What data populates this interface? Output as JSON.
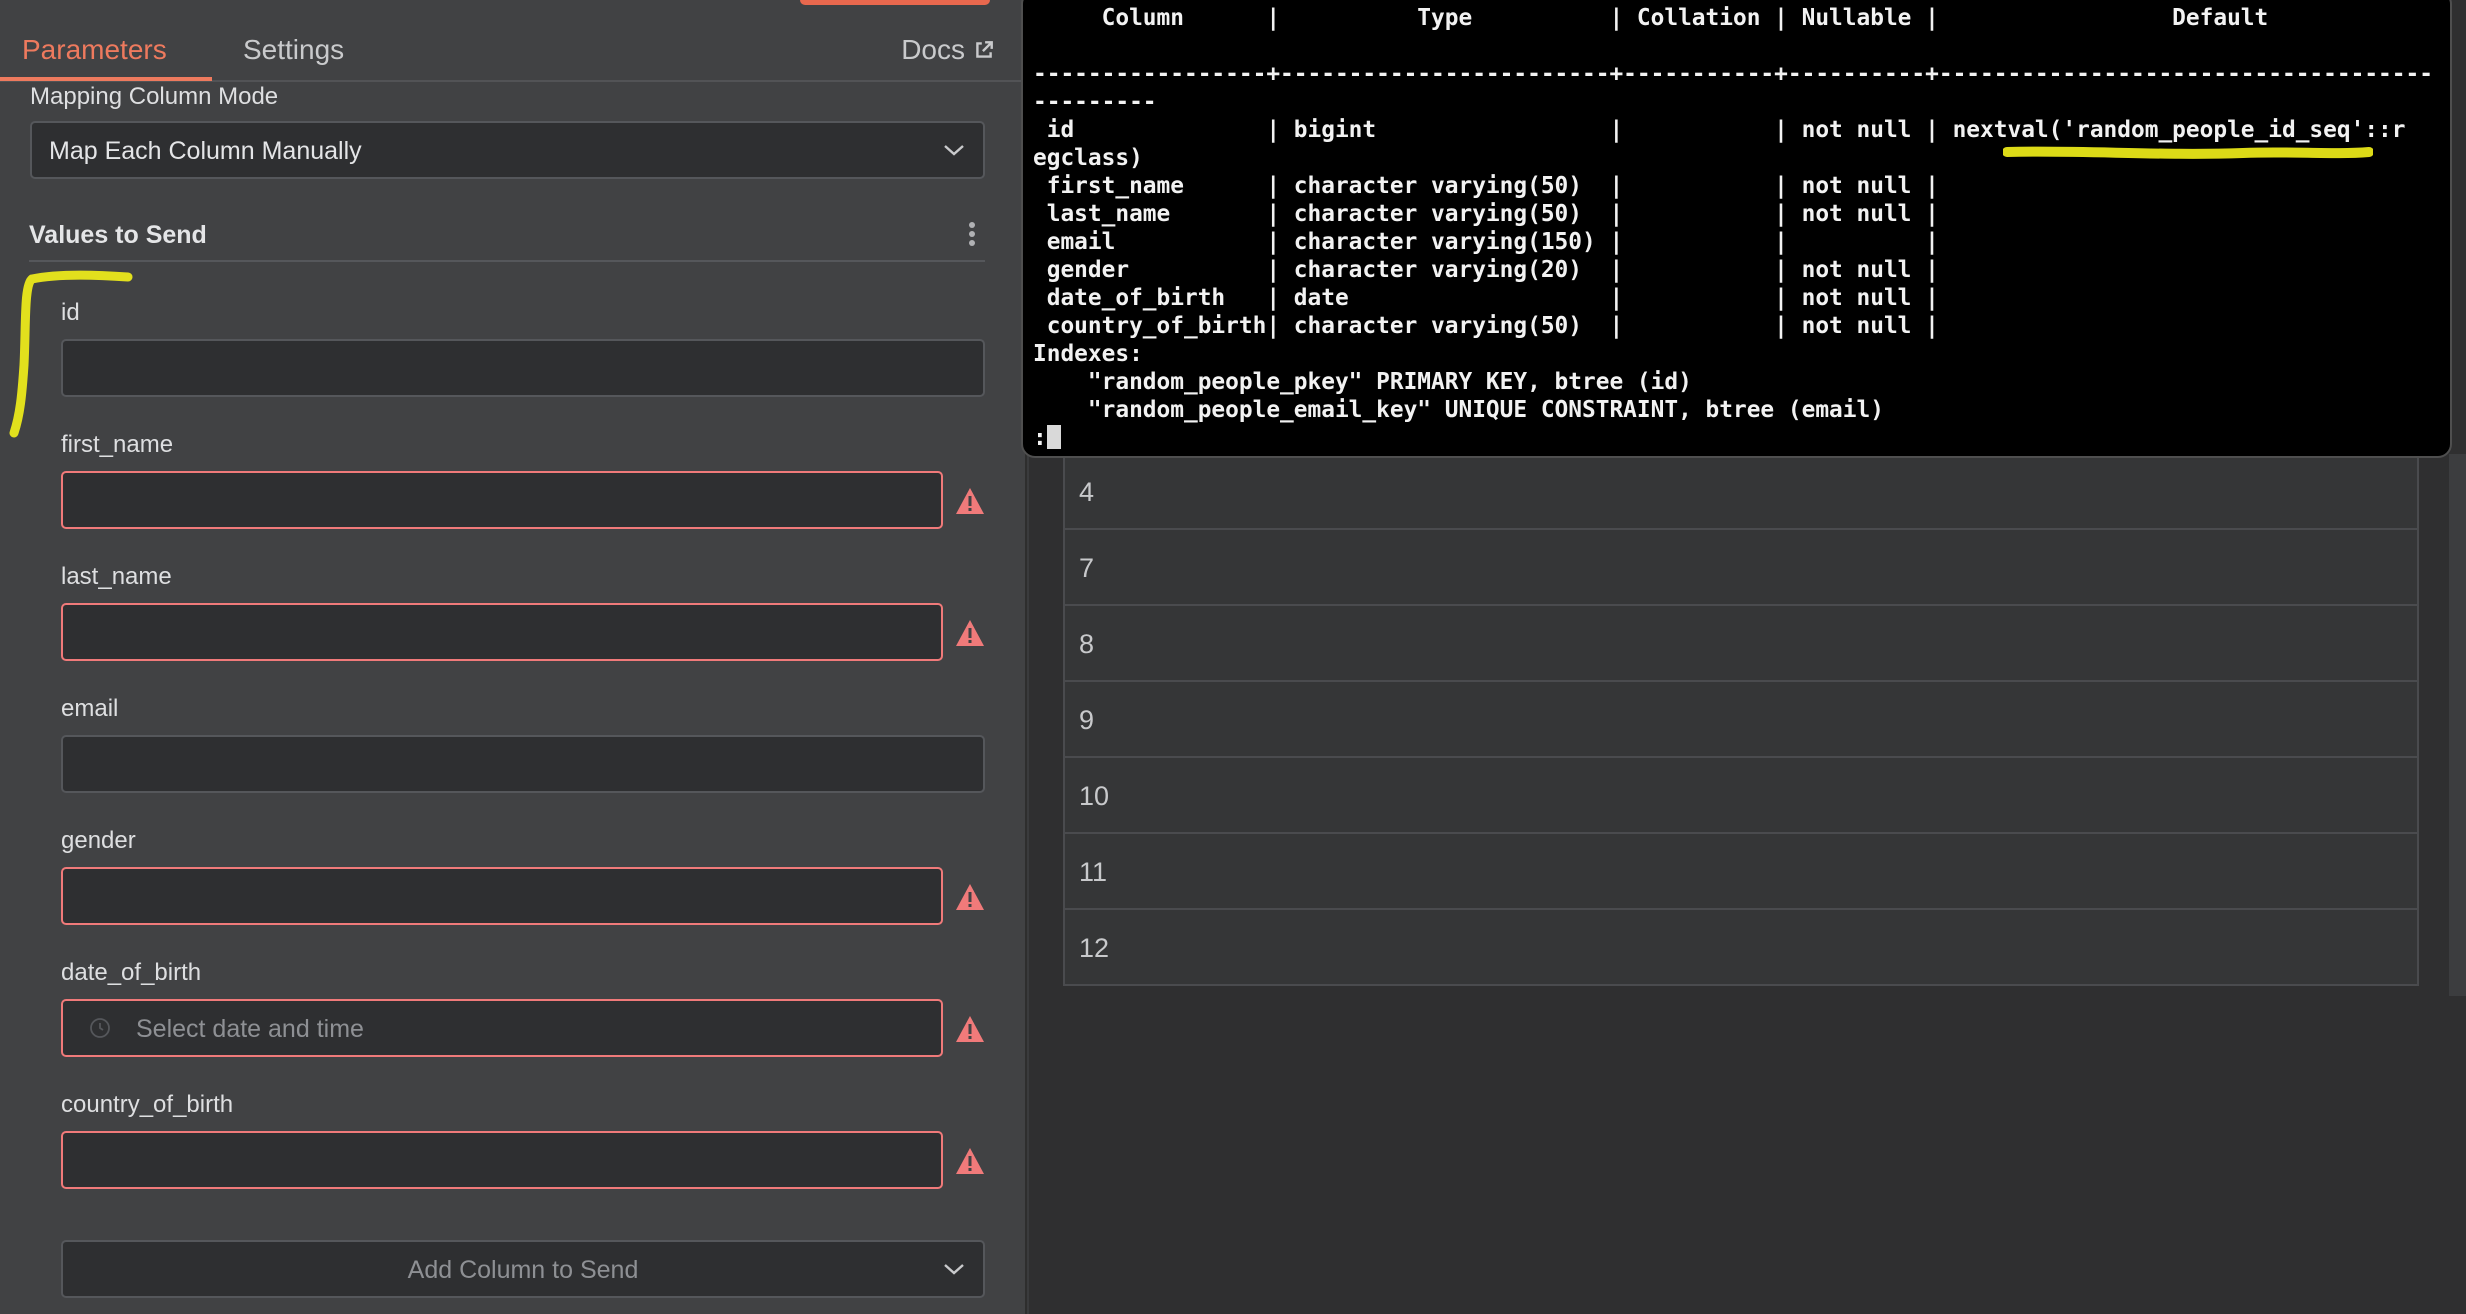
{
  "tabs": {
    "parameters": "Parameters",
    "settings": "Settings",
    "docs": "Docs"
  },
  "mapping": {
    "label": "Mapping Column Mode",
    "value": "Map Each Column Manually"
  },
  "values_section": {
    "title": "Values to Send"
  },
  "fields": [
    {
      "label": "id",
      "value": "",
      "error": false
    },
    {
      "label": "first_name",
      "value": "",
      "error": true
    },
    {
      "label": "last_name",
      "value": "",
      "error": true
    },
    {
      "label": "email",
      "value": "",
      "error": false
    },
    {
      "label": "gender",
      "value": "",
      "error": true
    },
    {
      "label": "date_of_birth",
      "placeholder": "Select date and time",
      "error": true
    },
    {
      "label": "country_of_birth",
      "value": "",
      "error": true
    }
  ],
  "add_column": {
    "label": "Add Column to Send"
  },
  "results": {
    "rows": [
      "4",
      "7",
      "8",
      "9",
      "10",
      "11",
      "12"
    ]
  },
  "terminal": {
    "lines": [
      "     Column      |          Type          | Collation | Nullable |                 Default",
      "",
      "-----------------+------------------------+-----------+----------+------------------------------------",
      "---------",
      " id              | bigint                 |           | not null | nextval('random_people_id_seq'::r",
      "egclass)",
      " first_name      | character varying(50)  |           | not null |",
      " last_name       | character varying(50)  |           | not null |",
      " email           | character varying(150) |           |          |",
      " gender          | character varying(20)  |           | not null |",
      " date_of_birth   | date                   |           | not null |",
      " country_of_birth| character varying(50)  |           | not null |",
      "Indexes:",
      "    \"random_people_pkey\" PRIMARY KEY, btree (id)",
      "    \"random_people_email_key\" UNIQUE CONSTRAINT, btree (email)"
    ],
    "prompt": ":"
  },
  "colors": {
    "accent": "#ee7a5e",
    "error_border": "#f07a7a",
    "highlight": "#f4f21a"
  }
}
